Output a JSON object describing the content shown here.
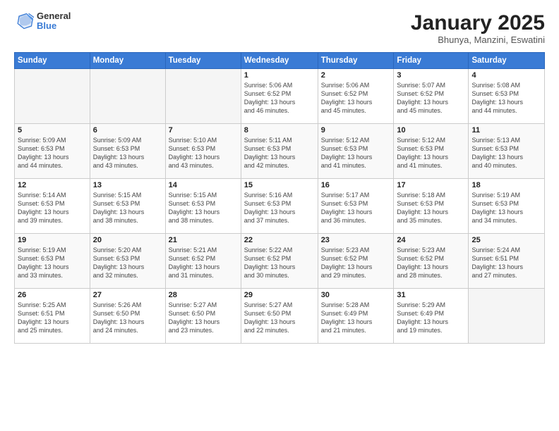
{
  "header": {
    "logo_general": "General",
    "logo_blue": "Blue",
    "month": "January 2025",
    "location": "Bhunya, Manzini, Eswatini"
  },
  "weekdays": [
    "Sunday",
    "Monday",
    "Tuesday",
    "Wednesday",
    "Thursday",
    "Friday",
    "Saturday"
  ],
  "weeks": [
    [
      {
        "day": "",
        "info": ""
      },
      {
        "day": "",
        "info": ""
      },
      {
        "day": "",
        "info": ""
      },
      {
        "day": "1",
        "info": "Sunrise: 5:06 AM\nSunset: 6:52 PM\nDaylight: 13 hours\nand 46 minutes."
      },
      {
        "day": "2",
        "info": "Sunrise: 5:06 AM\nSunset: 6:52 PM\nDaylight: 13 hours\nand 45 minutes."
      },
      {
        "day": "3",
        "info": "Sunrise: 5:07 AM\nSunset: 6:52 PM\nDaylight: 13 hours\nand 45 minutes."
      },
      {
        "day": "4",
        "info": "Sunrise: 5:08 AM\nSunset: 6:53 PM\nDaylight: 13 hours\nand 44 minutes."
      }
    ],
    [
      {
        "day": "5",
        "info": "Sunrise: 5:09 AM\nSunset: 6:53 PM\nDaylight: 13 hours\nand 44 minutes."
      },
      {
        "day": "6",
        "info": "Sunrise: 5:09 AM\nSunset: 6:53 PM\nDaylight: 13 hours\nand 43 minutes."
      },
      {
        "day": "7",
        "info": "Sunrise: 5:10 AM\nSunset: 6:53 PM\nDaylight: 13 hours\nand 43 minutes."
      },
      {
        "day": "8",
        "info": "Sunrise: 5:11 AM\nSunset: 6:53 PM\nDaylight: 13 hours\nand 42 minutes."
      },
      {
        "day": "9",
        "info": "Sunrise: 5:12 AM\nSunset: 6:53 PM\nDaylight: 13 hours\nand 41 minutes."
      },
      {
        "day": "10",
        "info": "Sunrise: 5:12 AM\nSunset: 6:53 PM\nDaylight: 13 hours\nand 41 minutes."
      },
      {
        "day": "11",
        "info": "Sunrise: 5:13 AM\nSunset: 6:53 PM\nDaylight: 13 hours\nand 40 minutes."
      }
    ],
    [
      {
        "day": "12",
        "info": "Sunrise: 5:14 AM\nSunset: 6:53 PM\nDaylight: 13 hours\nand 39 minutes."
      },
      {
        "day": "13",
        "info": "Sunrise: 5:15 AM\nSunset: 6:53 PM\nDaylight: 13 hours\nand 38 minutes."
      },
      {
        "day": "14",
        "info": "Sunrise: 5:15 AM\nSunset: 6:53 PM\nDaylight: 13 hours\nand 38 minutes."
      },
      {
        "day": "15",
        "info": "Sunrise: 5:16 AM\nSunset: 6:53 PM\nDaylight: 13 hours\nand 37 minutes."
      },
      {
        "day": "16",
        "info": "Sunrise: 5:17 AM\nSunset: 6:53 PM\nDaylight: 13 hours\nand 36 minutes."
      },
      {
        "day": "17",
        "info": "Sunrise: 5:18 AM\nSunset: 6:53 PM\nDaylight: 13 hours\nand 35 minutes."
      },
      {
        "day": "18",
        "info": "Sunrise: 5:19 AM\nSunset: 6:53 PM\nDaylight: 13 hours\nand 34 minutes."
      }
    ],
    [
      {
        "day": "19",
        "info": "Sunrise: 5:19 AM\nSunset: 6:53 PM\nDaylight: 13 hours\nand 33 minutes."
      },
      {
        "day": "20",
        "info": "Sunrise: 5:20 AM\nSunset: 6:53 PM\nDaylight: 13 hours\nand 32 minutes."
      },
      {
        "day": "21",
        "info": "Sunrise: 5:21 AM\nSunset: 6:52 PM\nDaylight: 13 hours\nand 31 minutes."
      },
      {
        "day": "22",
        "info": "Sunrise: 5:22 AM\nSunset: 6:52 PM\nDaylight: 13 hours\nand 30 minutes."
      },
      {
        "day": "23",
        "info": "Sunrise: 5:23 AM\nSunset: 6:52 PM\nDaylight: 13 hours\nand 29 minutes."
      },
      {
        "day": "24",
        "info": "Sunrise: 5:23 AM\nSunset: 6:52 PM\nDaylight: 13 hours\nand 28 minutes."
      },
      {
        "day": "25",
        "info": "Sunrise: 5:24 AM\nSunset: 6:51 PM\nDaylight: 13 hours\nand 27 minutes."
      }
    ],
    [
      {
        "day": "26",
        "info": "Sunrise: 5:25 AM\nSunset: 6:51 PM\nDaylight: 13 hours\nand 25 minutes."
      },
      {
        "day": "27",
        "info": "Sunrise: 5:26 AM\nSunset: 6:50 PM\nDaylight: 13 hours\nand 24 minutes."
      },
      {
        "day": "28",
        "info": "Sunrise: 5:27 AM\nSunset: 6:50 PM\nDaylight: 13 hours\nand 23 minutes."
      },
      {
        "day": "29",
        "info": "Sunrise: 5:27 AM\nSunset: 6:50 PM\nDaylight: 13 hours\nand 22 minutes."
      },
      {
        "day": "30",
        "info": "Sunrise: 5:28 AM\nSunset: 6:49 PM\nDaylight: 13 hours\nand 21 minutes."
      },
      {
        "day": "31",
        "info": "Sunrise: 5:29 AM\nSunset: 6:49 PM\nDaylight: 13 hours\nand 19 minutes."
      },
      {
        "day": "",
        "info": ""
      }
    ]
  ]
}
